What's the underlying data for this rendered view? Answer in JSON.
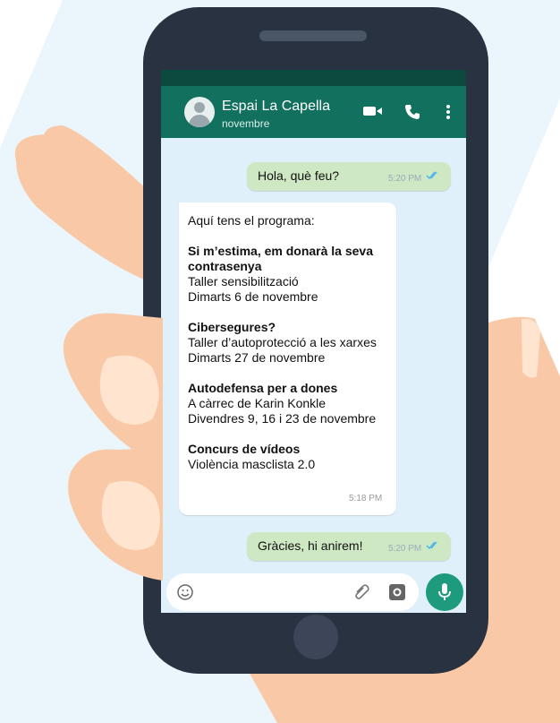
{
  "contact": {
    "name": "Espai La Capella",
    "subtitle": "novembre"
  },
  "header_icons": [
    "video-call-icon",
    "phone-icon",
    "more-options-icon"
  ],
  "messages": {
    "m1": {
      "text": "Hola, què feu?",
      "time": "5:20 PM",
      "status": "read"
    },
    "program": {
      "intro": "Aquí tens el programa:",
      "e1_title_1": "Si m’estima, em donarà la seva",
      "e1_title_2": "contrasenya",
      "e1_l1": "Taller sensibilització",
      "e1_l2": "Dimarts 6 de novembre",
      "e2_title": "Cibersegures?",
      "e2_l1": "Taller d’autoprotecció a les xarxes",
      "e2_l2": "Dimarts 27 de novembre",
      "e3_title": "Autodefensa per a dones",
      "e3_l1": "A càrrec de Karin Konkle",
      "e3_l2": "Divendres 9, 16 i 23 de novembre",
      "e4_title": "Concurs de vídeos",
      "e4_l1": "Violència masclista 2.0",
      "time": "5:18 PM"
    },
    "m3": {
      "text": "Gràcies, hi anirem!",
      "time": "5:20 PM",
      "status": "read"
    }
  },
  "input_icons": [
    "emoji-icon",
    "attach-icon",
    "camera-icon",
    "mic-icon"
  ],
  "colors": {
    "header": "#12705e",
    "status_bar": "#0c4a40",
    "chat_bg": "#e0f0fa",
    "outgoing": "#cfe8c4",
    "mic": "#1d9b7c",
    "phone": "#293241",
    "skin": "#f9c9a7",
    "bg_stripe": "#eaf5fc"
  }
}
